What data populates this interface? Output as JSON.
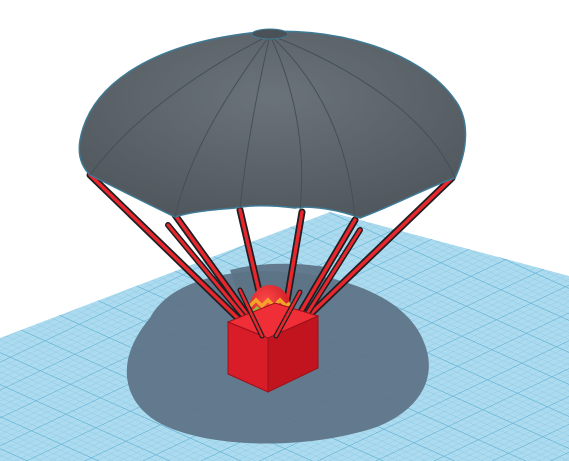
{
  "scene": {
    "objects": [
      {
        "id": "workplane",
        "type": "grid-plane",
        "color": "#a9d9ec",
        "line_color": "#5fb3d6"
      },
      {
        "id": "parachute-canopy",
        "type": "dome",
        "color": "#5b6369",
        "edge_color": "#3d6d86"
      },
      {
        "id": "suspension-lines",
        "type": "cords",
        "count": 8,
        "color": "#e8262d",
        "outline_color": "#1f1f22"
      },
      {
        "id": "cargo-box",
        "type": "cube",
        "color": "#e01f2c"
      },
      {
        "id": "easter-egg",
        "type": "egg",
        "color": "#e3252b",
        "stripe_colors": [
          "#f2a428",
          "#8fbf3a",
          "#f0d64a"
        ]
      }
    ],
    "colors": {
      "background": "#ffffff",
      "grid_fill": "#a9d9ec",
      "grid_line": "#5fb3d6",
      "shadow": "#5f7589",
      "canopy": "#5b6369",
      "cord": "#e8262d",
      "box": "#e01f2c"
    }
  }
}
